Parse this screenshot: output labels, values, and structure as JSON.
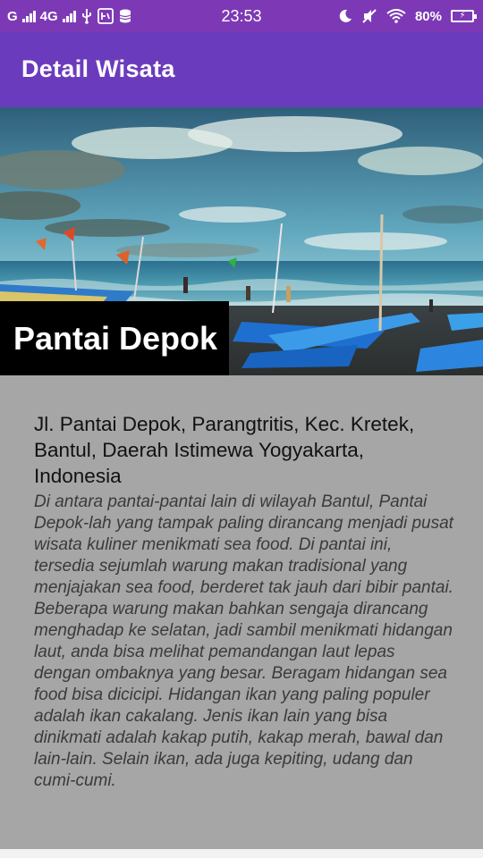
{
  "status_bar": {
    "network_1": "G",
    "network_2": "4G",
    "icon_usb": "usb-icon",
    "icon_app": "app-notification-icon",
    "icon_storage": "storage-icon",
    "time": "23:53",
    "icon_dnd": "moon-icon",
    "icon_mute": "muted-icon",
    "icon_wifi": "wifi-icon",
    "battery_percent": "80%",
    "bg_color": "#7d39b5"
  },
  "app_bar": {
    "title": "Detail Wisata",
    "bg_color": "#6b3bbd"
  },
  "hero": {
    "place_name": "Pantai Depok"
  },
  "detail": {
    "address": "Jl. Pantai Depok, Parangtritis, Kec. Kretek, Bantul, Daerah Istimewa Yogyakarta, Indonesia",
    "description": "Di antara pantai-pantai lain di wilayah Bantul, Pantai Depok-lah yang tampak paling dirancang menjadi pusat wisata kuliner menikmati sea food. Di pantai ini, tersedia sejumlah warung makan tradisional yang menjajakan sea food, berderet tak jauh dari bibir pantai. Beberapa warung makan bahkan sengaja dirancang menghadap ke selatan, jadi sambil menikmati hidangan laut, anda bisa melihat pemandangan laut lepas dengan ombaknya yang besar. Beragam hidangan sea food bisa dicicipi. Hidangan ikan yang paling populer adalah ikan cakalang. Jenis ikan lain yang bisa dinikmati adalah kakap putih, kakap merah, bawal dan lain-lain. Selain ikan, ada juga kepiting, udang dan cumi-cumi."
  }
}
